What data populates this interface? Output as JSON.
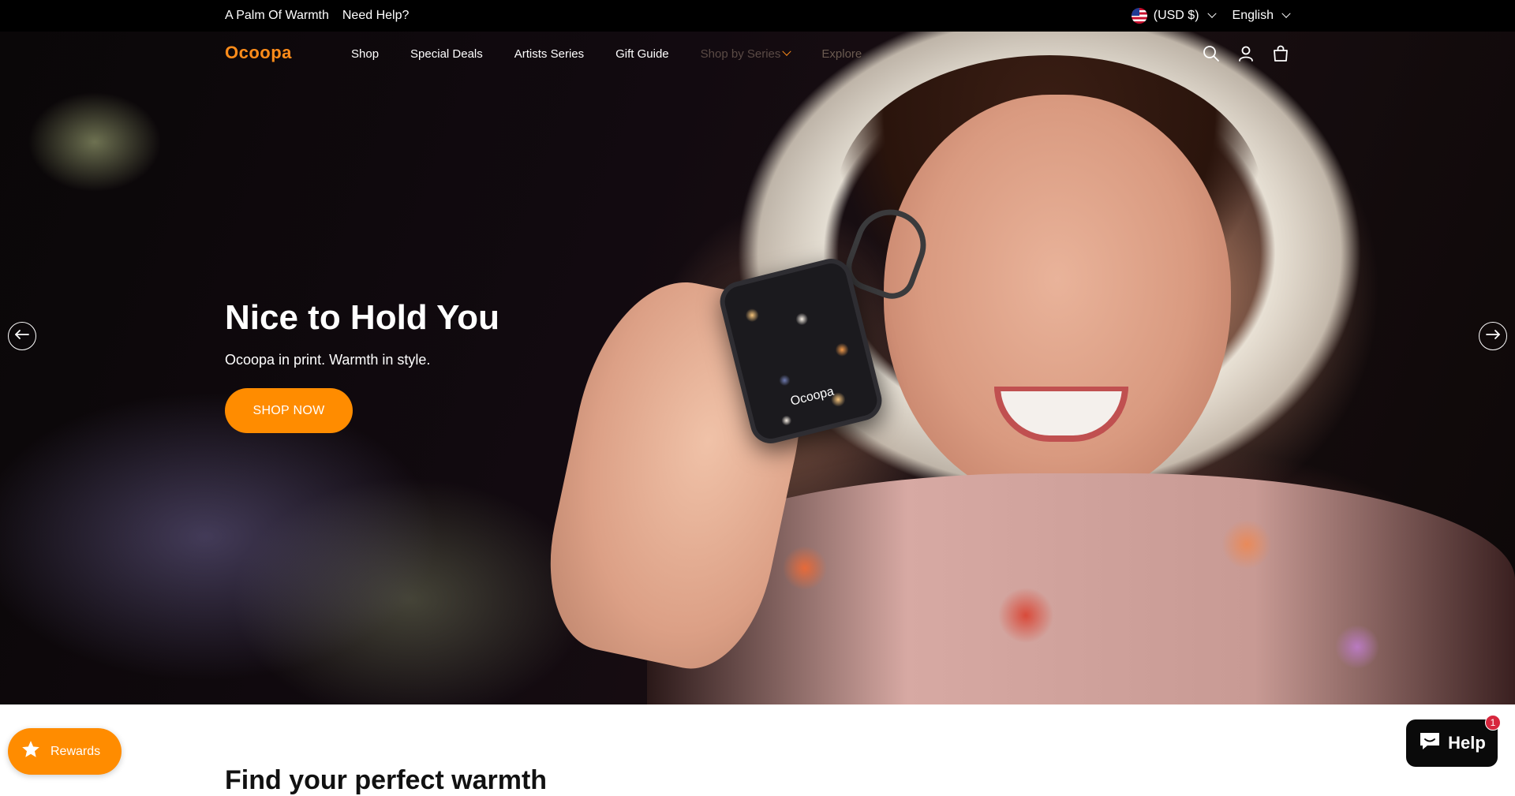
{
  "announcement": {
    "links": [
      "A Palm Of Warmth",
      "Need Help?"
    ],
    "currency": "(USD $)",
    "language": "English"
  },
  "header": {
    "logo": "Ocoopa",
    "nav": [
      "Shop",
      "Special Deals",
      "Artists Series",
      "Gift Guide",
      "Shop by Series",
      "Explore"
    ]
  },
  "hero": {
    "title": "Nice to Hold You",
    "subtitle": "Ocoopa in print. Warmth in style.",
    "cta": "SHOP NOW",
    "device_brand": "Ocoopa"
  },
  "section": {
    "title": "Find your perfect warmth"
  },
  "widgets": {
    "rewards_label": "Rewards",
    "help_label": "Help",
    "help_badge": "1"
  },
  "colors": {
    "accent": "#ff8c00",
    "announcement_bg": "#000000",
    "help_bg": "#0a0a0a",
    "badge": "#d7263d"
  },
  "icons": [
    "search-icon",
    "account-icon",
    "cart-icon",
    "arrow-left-icon",
    "arrow-right-icon",
    "star-icon",
    "chat-icon",
    "us-flag-icon"
  ]
}
